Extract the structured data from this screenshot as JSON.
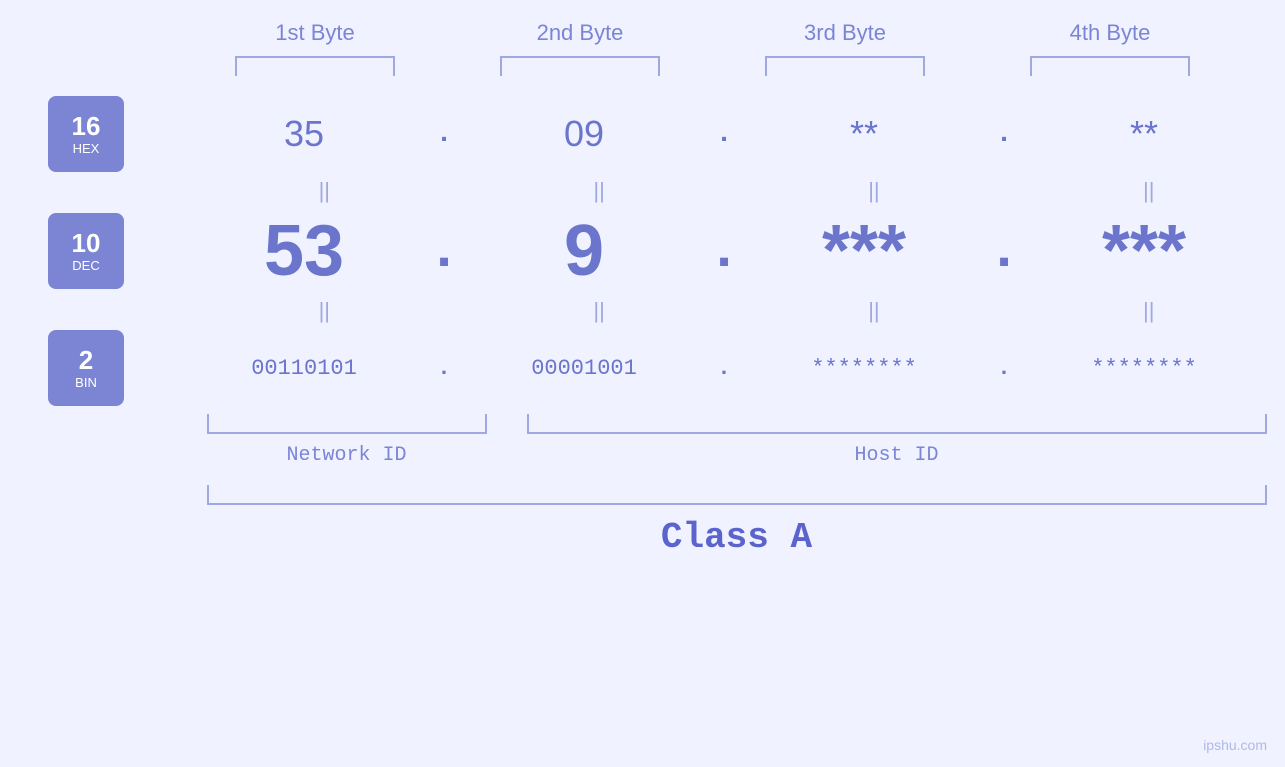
{
  "headers": {
    "byte1": "1st Byte",
    "byte2": "2nd Byte",
    "byte3": "3rd Byte",
    "byte4": "4th Byte"
  },
  "badges": {
    "hex": {
      "number": "16",
      "label": "HEX"
    },
    "dec": {
      "number": "10",
      "label": "DEC"
    },
    "bin": {
      "number": "2",
      "label": "BIN"
    }
  },
  "values": {
    "hex": [
      "35",
      "09",
      "**",
      "**"
    ],
    "dec": [
      "53",
      "9",
      "***",
      "***"
    ],
    "bin": [
      "00110101",
      "00001001",
      "********",
      "********"
    ]
  },
  "labels": {
    "network_id": "Network ID",
    "host_id": "Host ID",
    "class": "Class A"
  },
  "watermark": "ipshu.com"
}
